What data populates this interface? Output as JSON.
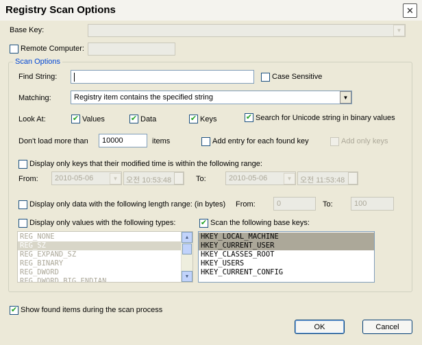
{
  "window": {
    "title": "Registry Scan Options",
    "close_glyph": "✕"
  },
  "base_key": {
    "label": "Base Key:",
    "value": ""
  },
  "remote_computer": {
    "label": "Remote Computer:",
    "checked": false,
    "value": ""
  },
  "scan_options": {
    "group_title": "Scan Options",
    "find_string": {
      "label": "Find String:",
      "value": ""
    },
    "case_sensitive": {
      "label": "Case Sensitive",
      "checked": false
    },
    "matching": {
      "label": "Matching:",
      "value": "Registry item contains the specified string"
    },
    "look_at": {
      "label": "Look At:",
      "values": {
        "label": "Values",
        "checked": true
      },
      "data": {
        "label": "Data",
        "checked": true
      },
      "keys": {
        "label": "Keys",
        "checked": true
      },
      "unicode": {
        "label": "Search for Unicode string in binary values",
        "checked": true
      }
    },
    "dont_load": {
      "label": "Don't load more than",
      "value": "10000",
      "suffix": "items"
    },
    "add_entry": {
      "label": "Add entry for each found key",
      "checked": false
    },
    "add_only_keys": {
      "label": "Add only keys",
      "checked": false
    },
    "modified_time": {
      "label": "Display only keys that their modified time is within the following range:",
      "checked": false,
      "from_label": "From:",
      "from_date": "2010-05-06",
      "from_time": "오전 10:53:48",
      "to_label": "To:",
      "to_date": "2010-05-06",
      "to_time": "오전 11:53:48"
    },
    "length_range": {
      "label": "Display only data with the following length range: (in bytes)",
      "checked": false,
      "from_label": "From:",
      "from_value": "0",
      "to_label": "To:",
      "to_value": "100"
    },
    "value_types": {
      "label": "Display only values with the following types:",
      "checked": false,
      "items": [
        "REG_NONE",
        "REG_SZ",
        "REG_EXPAND_SZ",
        "REG_BINARY",
        "REG_DWORD",
        "REG_DWORD_BIG_ENDIAN"
      ],
      "selected_index": 1
    },
    "base_keys": {
      "label": "Scan the following base keys:",
      "checked": true,
      "items": [
        "HKEY_LOCAL_MACHINE",
        "HKEY_CURRENT_USER",
        "HKEY_CLASSES_ROOT",
        "HKEY_USERS",
        "HKEY_CURRENT_CONFIG"
      ],
      "selected_indices": [
        0,
        1
      ]
    }
  },
  "show_found": {
    "label": "Show found items during the scan process",
    "checked": true
  },
  "buttons": {
    "ok": "OK",
    "cancel": "Cancel"
  },
  "colors": {
    "group_title": "#0046d5",
    "selection": "#aca899",
    "check": "#21a121",
    "dialog_bg": "#ece9d8"
  }
}
